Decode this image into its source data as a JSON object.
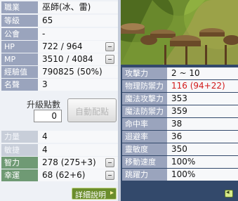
{
  "colors": {
    "panel_dark": "#33496b",
    "label_blue": "#9aa4bd",
    "label_green": "#6f9a74",
    "accent_red": "#d21a1a"
  },
  "basic": [
    {
      "label": "職業",
      "value": "巫師(冰、雷)"
    },
    {
      "label": "等級",
      "value": "65"
    },
    {
      "label": "公會",
      "value": "-"
    },
    {
      "label": "HP",
      "value": "722 / 964"
    },
    {
      "label": "MP",
      "value": "3510 / 4084"
    },
    {
      "label": "經驗值",
      "value": "790825 (50%)"
    },
    {
      "label": "名聲",
      "value": "3"
    }
  ],
  "points": {
    "label": "升級點數",
    "value": "0",
    "auto_button": "自動配點"
  },
  "attributes": [
    {
      "label": "力量",
      "value": "4"
    },
    {
      "label": "敏捷",
      "value": "4"
    },
    {
      "label": "智力",
      "value": "278 (275+3)"
    },
    {
      "label": "幸運",
      "value": "68 (62+6)"
    }
  ],
  "detail_button": "詳細說明",
  "combat": [
    {
      "label": "攻擊力",
      "value": "2 ~ 10"
    },
    {
      "label": "物理防禦力",
      "value": "116 (94+22)"
    },
    {
      "label": "魔法攻擊力",
      "value": "353"
    },
    {
      "label": "魔法防禦力",
      "value": "359"
    },
    {
      "label": "命中率",
      "value": "38"
    },
    {
      "label": "迴避率",
      "value": "36"
    },
    {
      "label": "靈敏度",
      "value": "350"
    },
    {
      "label": "移動速度",
      "value": "100%"
    },
    {
      "label": "跳躍力",
      "value": "100%"
    }
  ]
}
